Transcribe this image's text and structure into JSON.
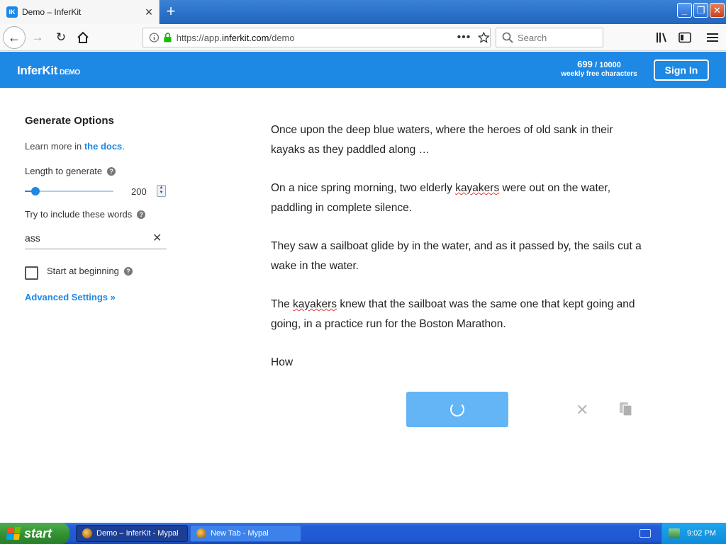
{
  "browser": {
    "tab_title": "Demo – InferKit",
    "tab_favicon_text": "IK",
    "url_prefix": "https://app.",
    "url_domain": "inferkit.com",
    "url_path": "/demo",
    "search_placeholder": "Search"
  },
  "header": {
    "brand": "InferKit",
    "brand_tag": "DEMO",
    "quota_used": "699",
    "quota_total": "/ 10000",
    "quota_label": "weekly free characters",
    "signin_label": "Sign In",
    "accent_color": "#1e88e5"
  },
  "options": {
    "title": "Generate Options",
    "docs_prefix": "Learn more in ",
    "docs_link": "the docs",
    "docs_suffix": ".",
    "length_label": "Length to generate",
    "length_value": "200",
    "length_slider_fraction": 0.12,
    "words_label": "Try to include these words",
    "words_value": "ass",
    "start_label": "Start at beginning",
    "start_checked": false,
    "advanced_label": "Advanced Settings »"
  },
  "story": {
    "p1": "Once upon the deep blue waters, where the heroes of old sank in their kayaks as they paddled along …",
    "p2_a": "On a nice spring morning, two elderly ",
    "p2_b": "kayakers",
    "p2_c": " were out on the water, paddling in complete silence.",
    "p3": "They saw a sailboat glide by in the water, and as it passed by, the sails cut a wake in the water.",
    "p4_a": "The ",
    "p4_b": "kayakers",
    "p4_c": " knew that the sailboat was the same one that kept going and going, in a practice run for the Boston Marathon.",
    "p5": "How"
  },
  "taskbar": {
    "start_label": "start",
    "task1": "Demo – InferKit - Mypal",
    "task2": "New Tab - Mypal",
    "clock": "9:02 PM"
  }
}
